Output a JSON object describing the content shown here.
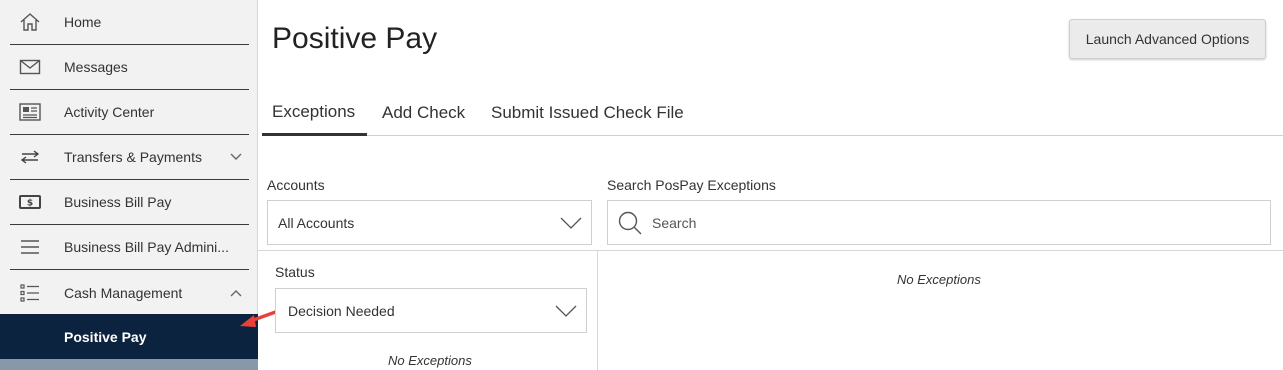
{
  "sidebar": {
    "items": [
      {
        "label": "Home",
        "icon": "home-icon"
      },
      {
        "label": "Messages",
        "icon": "envelope-icon"
      },
      {
        "label": "Activity Center",
        "icon": "newspaper-icon"
      },
      {
        "label": "Transfers & Payments",
        "icon": "transfer-arrows-icon",
        "chevron": "down"
      },
      {
        "label": "Business Bill Pay",
        "icon": "dollar-bill-icon"
      },
      {
        "label": "Business Bill Pay Admini...",
        "icon": "hamburger-icon"
      },
      {
        "label": "Cash Management",
        "icon": "checklist-icon",
        "chevron": "up"
      }
    ],
    "active_item": {
      "label": "Positive Pay"
    }
  },
  "header": {
    "title": "Positive Pay",
    "launch_button": "Launch Advanced Options"
  },
  "tabs": [
    {
      "label": "Exceptions",
      "active": true
    },
    {
      "label": "Add Check",
      "active": false
    },
    {
      "label": "Submit Issued Check File",
      "active": false
    }
  ],
  "filters": {
    "accounts_label": "Accounts",
    "accounts_value": "All Accounts",
    "search_label": "Search PosPay Exceptions",
    "search_placeholder": "Search",
    "status_label": "Status",
    "status_value": "Decision Needed"
  },
  "results": {
    "left_empty": "No Exceptions",
    "right_empty": "No Exceptions"
  },
  "colors": {
    "active_nav_bg": "#0c2340",
    "annotation_arrow": "#e8413a"
  }
}
